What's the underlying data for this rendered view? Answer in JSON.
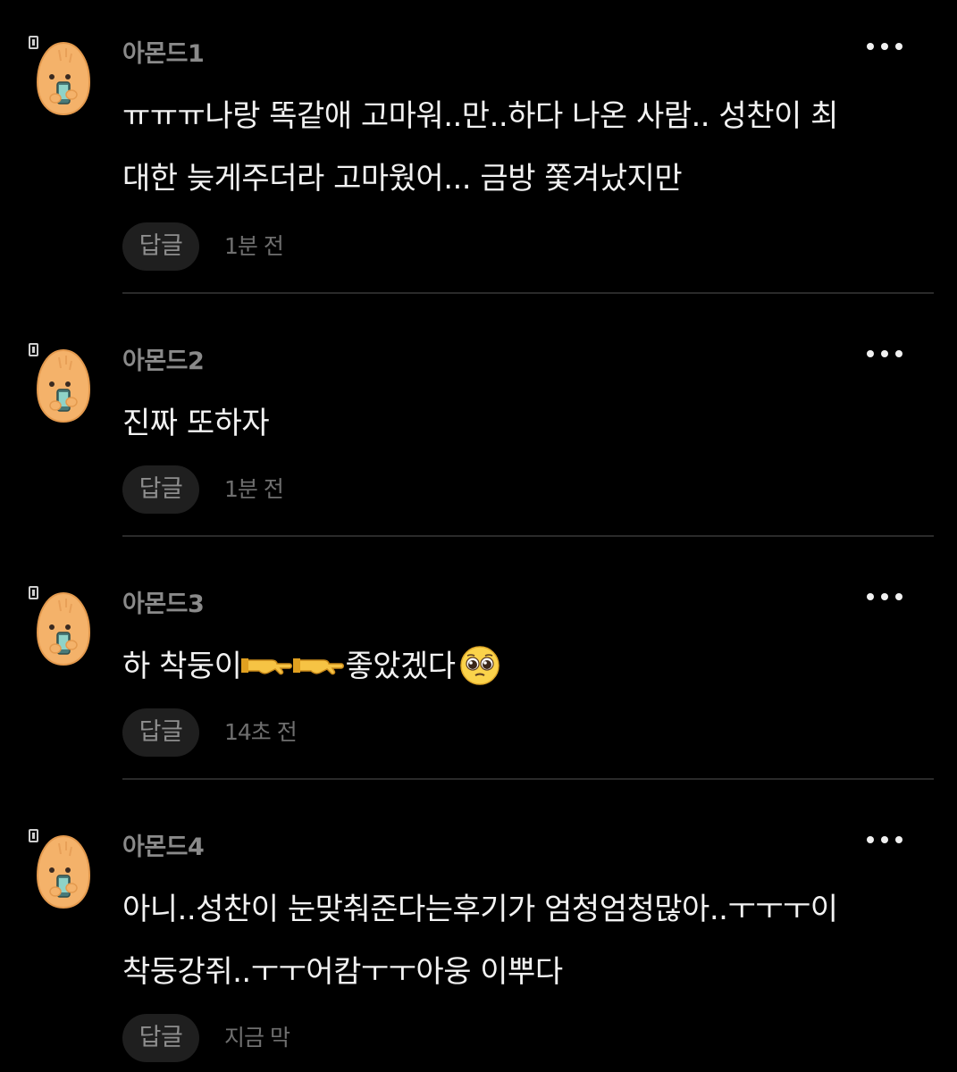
{
  "comments": [
    {
      "author": "아몬드1",
      "text_lines": [
        "ㅠㅠㅠ나랑 똑같애 고마워..만..하다 나온 사람.. 성찬이 최",
        "대한 늦게주더라 고마웠어... 금방 쫓겨났지만"
      ],
      "reply_label": "답글",
      "time": "1분 전"
    },
    {
      "author": "아몬드2",
      "text_lines": [
        "진짜 또하자"
      ],
      "reply_label": "답글",
      "time": "1분 전"
    },
    {
      "author": "아몬드3",
      "text_parts": [
        "하 착둥이",
        "좋았겠다"
      ],
      "emoji": [
        "pointing-hand-emoji",
        "pointing-hand-emoji",
        "pleading-face-emoji"
      ],
      "reply_label": "답글",
      "time": "14초 전"
    },
    {
      "author": "아몬드4",
      "text_lines": [
        "아니..성찬이 눈맞춰준다는후기가 엄청엄청많아..ㅜㅜㅜ이",
        "착둥강쥐..ㅜㅜ어캄ㅜㅜ아웅 이뿌다"
      ],
      "reply_label": "답글",
      "time": "지금 막"
    }
  ],
  "colors": {
    "background": "#000000",
    "text": "#f2f2f2",
    "author": "#8a8a8a",
    "meta": "#6f6f6f",
    "reply_bg": "#1f1f1f",
    "divider": "#2a2a2a",
    "avatar": "#f4b26a"
  }
}
